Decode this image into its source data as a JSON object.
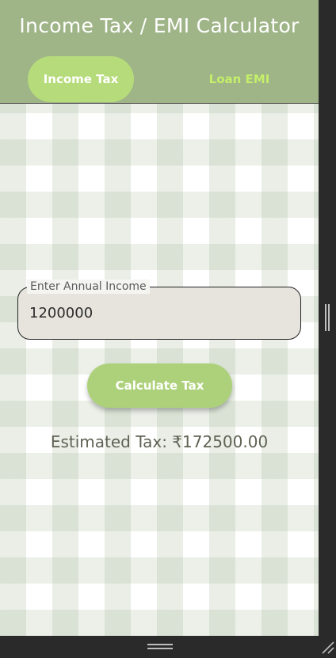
{
  "header": {
    "title": "Income Tax / EMI Calculator"
  },
  "tabs": [
    {
      "label": "Income Tax",
      "active": true
    },
    {
      "label": "Loan EMI",
      "active": false
    }
  ],
  "income_field": {
    "label": "Enter Annual Income",
    "value": "1200000"
  },
  "calculate_button": {
    "label": "Calculate Tax"
  },
  "result": {
    "text": "Estimated Tax: ₹172500.00"
  },
  "colors": {
    "header_bg": "#9fb487",
    "active_tab_bg": "#b6db7b",
    "inactive_tab_text": "#c4ef6a",
    "button_bg": "#add17a",
    "input_bg": "#e6e4dd"
  },
  "icons": {
    "resize_right": "vertical-resize-handle-icon",
    "resize_bottom": "horizontal-resize-handle-icon",
    "resize_corner": "corner-resize-grip-icon"
  }
}
